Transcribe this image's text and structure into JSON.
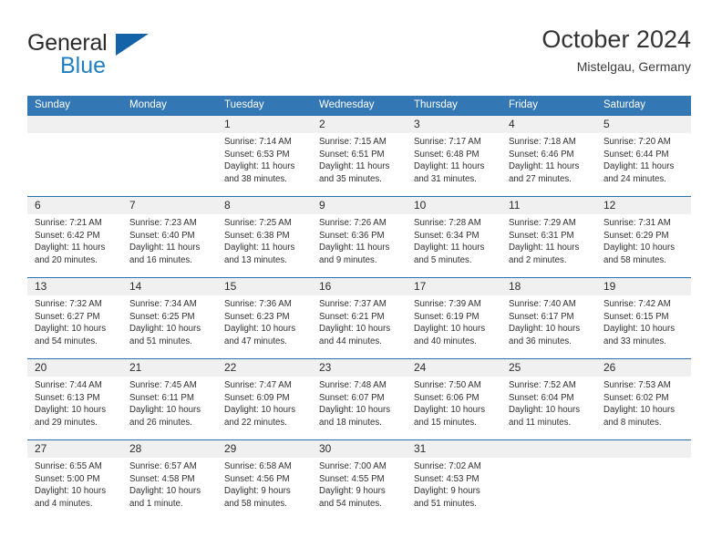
{
  "brand": {
    "name_primary": "General",
    "name_secondary": "Blue",
    "accent_color": "#1463a8",
    "blue_text_color": "#1f7fc4"
  },
  "header": {
    "title": "October 2024",
    "subtitle": "Mistelgau, Germany"
  },
  "theme": {
    "header_row_bg": "#3377b5",
    "week_divider": "#2a6fb0",
    "date_row_bg": "#f0f0f0",
    "text_color": "#2f2f2f"
  },
  "weekday_headers": [
    "Sunday",
    "Monday",
    "Tuesday",
    "Wednesday",
    "Thursday",
    "Friday",
    "Saturday"
  ],
  "weeks": [
    {
      "days": [
        {
          "date": "",
          "sunrise": "",
          "sunset": "",
          "daylight_line1": "",
          "daylight_line2": "",
          "empty": true
        },
        {
          "date": "",
          "sunrise": "",
          "sunset": "",
          "daylight_line1": "",
          "daylight_line2": "",
          "empty": true
        },
        {
          "date": "1",
          "sunrise": "Sunrise: 7:14 AM",
          "sunset": "Sunset: 6:53 PM",
          "daylight_line1": "Daylight: 11 hours",
          "daylight_line2": "and 38 minutes.",
          "empty": false
        },
        {
          "date": "2",
          "sunrise": "Sunrise: 7:15 AM",
          "sunset": "Sunset: 6:51 PM",
          "daylight_line1": "Daylight: 11 hours",
          "daylight_line2": "and 35 minutes.",
          "empty": false
        },
        {
          "date": "3",
          "sunrise": "Sunrise: 7:17 AM",
          "sunset": "Sunset: 6:48 PM",
          "daylight_line1": "Daylight: 11 hours",
          "daylight_line2": "and 31 minutes.",
          "empty": false
        },
        {
          "date": "4",
          "sunrise": "Sunrise: 7:18 AM",
          "sunset": "Sunset: 6:46 PM",
          "daylight_line1": "Daylight: 11 hours",
          "daylight_line2": "and 27 minutes.",
          "empty": false
        },
        {
          "date": "5",
          "sunrise": "Sunrise: 7:20 AM",
          "sunset": "Sunset: 6:44 PM",
          "daylight_line1": "Daylight: 11 hours",
          "daylight_line2": "and 24 minutes.",
          "empty": false
        }
      ]
    },
    {
      "days": [
        {
          "date": "6",
          "sunrise": "Sunrise: 7:21 AM",
          "sunset": "Sunset: 6:42 PM",
          "daylight_line1": "Daylight: 11 hours",
          "daylight_line2": "and 20 minutes.",
          "empty": false
        },
        {
          "date": "7",
          "sunrise": "Sunrise: 7:23 AM",
          "sunset": "Sunset: 6:40 PM",
          "daylight_line1": "Daylight: 11 hours",
          "daylight_line2": "and 16 minutes.",
          "empty": false
        },
        {
          "date": "8",
          "sunrise": "Sunrise: 7:25 AM",
          "sunset": "Sunset: 6:38 PM",
          "daylight_line1": "Daylight: 11 hours",
          "daylight_line2": "and 13 minutes.",
          "empty": false
        },
        {
          "date": "9",
          "sunrise": "Sunrise: 7:26 AM",
          "sunset": "Sunset: 6:36 PM",
          "daylight_line1": "Daylight: 11 hours",
          "daylight_line2": "and 9 minutes.",
          "empty": false
        },
        {
          "date": "10",
          "sunrise": "Sunrise: 7:28 AM",
          "sunset": "Sunset: 6:34 PM",
          "daylight_line1": "Daylight: 11 hours",
          "daylight_line2": "and 5 minutes.",
          "empty": false
        },
        {
          "date": "11",
          "sunrise": "Sunrise: 7:29 AM",
          "sunset": "Sunset: 6:31 PM",
          "daylight_line1": "Daylight: 11 hours",
          "daylight_line2": "and 2 minutes.",
          "empty": false
        },
        {
          "date": "12",
          "sunrise": "Sunrise: 7:31 AM",
          "sunset": "Sunset: 6:29 PM",
          "daylight_line1": "Daylight: 10 hours",
          "daylight_line2": "and 58 minutes.",
          "empty": false
        }
      ]
    },
    {
      "days": [
        {
          "date": "13",
          "sunrise": "Sunrise: 7:32 AM",
          "sunset": "Sunset: 6:27 PM",
          "daylight_line1": "Daylight: 10 hours",
          "daylight_line2": "and 54 minutes.",
          "empty": false
        },
        {
          "date": "14",
          "sunrise": "Sunrise: 7:34 AM",
          "sunset": "Sunset: 6:25 PM",
          "daylight_line1": "Daylight: 10 hours",
          "daylight_line2": "and 51 minutes.",
          "empty": false
        },
        {
          "date": "15",
          "sunrise": "Sunrise: 7:36 AM",
          "sunset": "Sunset: 6:23 PM",
          "daylight_line1": "Daylight: 10 hours",
          "daylight_line2": "and 47 minutes.",
          "empty": false
        },
        {
          "date": "16",
          "sunrise": "Sunrise: 7:37 AM",
          "sunset": "Sunset: 6:21 PM",
          "daylight_line1": "Daylight: 10 hours",
          "daylight_line2": "and 44 minutes.",
          "empty": false
        },
        {
          "date": "17",
          "sunrise": "Sunrise: 7:39 AM",
          "sunset": "Sunset: 6:19 PM",
          "daylight_line1": "Daylight: 10 hours",
          "daylight_line2": "and 40 minutes.",
          "empty": false
        },
        {
          "date": "18",
          "sunrise": "Sunrise: 7:40 AM",
          "sunset": "Sunset: 6:17 PM",
          "daylight_line1": "Daylight: 10 hours",
          "daylight_line2": "and 36 minutes.",
          "empty": false
        },
        {
          "date": "19",
          "sunrise": "Sunrise: 7:42 AM",
          "sunset": "Sunset: 6:15 PM",
          "daylight_line1": "Daylight: 10 hours",
          "daylight_line2": "and 33 minutes.",
          "empty": false
        }
      ]
    },
    {
      "days": [
        {
          "date": "20",
          "sunrise": "Sunrise: 7:44 AM",
          "sunset": "Sunset: 6:13 PM",
          "daylight_line1": "Daylight: 10 hours",
          "daylight_line2": "and 29 minutes.",
          "empty": false
        },
        {
          "date": "21",
          "sunrise": "Sunrise: 7:45 AM",
          "sunset": "Sunset: 6:11 PM",
          "daylight_line1": "Daylight: 10 hours",
          "daylight_line2": "and 26 minutes.",
          "empty": false
        },
        {
          "date": "22",
          "sunrise": "Sunrise: 7:47 AM",
          "sunset": "Sunset: 6:09 PM",
          "daylight_line1": "Daylight: 10 hours",
          "daylight_line2": "and 22 minutes.",
          "empty": false
        },
        {
          "date": "23",
          "sunrise": "Sunrise: 7:48 AM",
          "sunset": "Sunset: 6:07 PM",
          "daylight_line1": "Daylight: 10 hours",
          "daylight_line2": "and 18 minutes.",
          "empty": false
        },
        {
          "date": "24",
          "sunrise": "Sunrise: 7:50 AM",
          "sunset": "Sunset: 6:06 PM",
          "daylight_line1": "Daylight: 10 hours",
          "daylight_line2": "and 15 minutes.",
          "empty": false
        },
        {
          "date": "25",
          "sunrise": "Sunrise: 7:52 AM",
          "sunset": "Sunset: 6:04 PM",
          "daylight_line1": "Daylight: 10 hours",
          "daylight_line2": "and 11 minutes.",
          "empty": false
        },
        {
          "date": "26",
          "sunrise": "Sunrise: 7:53 AM",
          "sunset": "Sunset: 6:02 PM",
          "daylight_line1": "Daylight: 10 hours",
          "daylight_line2": "and 8 minutes.",
          "empty": false
        }
      ]
    },
    {
      "days": [
        {
          "date": "27",
          "sunrise": "Sunrise: 6:55 AM",
          "sunset": "Sunset: 5:00 PM",
          "daylight_line1": "Daylight: 10 hours",
          "daylight_line2": "and 4 minutes.",
          "empty": false
        },
        {
          "date": "28",
          "sunrise": "Sunrise: 6:57 AM",
          "sunset": "Sunset: 4:58 PM",
          "daylight_line1": "Daylight: 10 hours",
          "daylight_line2": "and 1 minute.",
          "empty": false
        },
        {
          "date": "29",
          "sunrise": "Sunrise: 6:58 AM",
          "sunset": "Sunset: 4:56 PM",
          "daylight_line1": "Daylight: 9 hours",
          "daylight_line2": "and 58 minutes.",
          "empty": false
        },
        {
          "date": "30",
          "sunrise": "Sunrise: 7:00 AM",
          "sunset": "Sunset: 4:55 PM",
          "daylight_line1": "Daylight: 9 hours",
          "daylight_line2": "and 54 minutes.",
          "empty": false
        },
        {
          "date": "31",
          "sunrise": "Sunrise: 7:02 AM",
          "sunset": "Sunset: 4:53 PM",
          "daylight_line1": "Daylight: 9 hours",
          "daylight_line2": "and 51 minutes.",
          "empty": false
        },
        {
          "date": "",
          "sunrise": "",
          "sunset": "",
          "daylight_line1": "",
          "daylight_line2": "",
          "empty": true
        },
        {
          "date": "",
          "sunrise": "",
          "sunset": "",
          "daylight_line1": "",
          "daylight_line2": "",
          "empty": true
        }
      ]
    }
  ]
}
